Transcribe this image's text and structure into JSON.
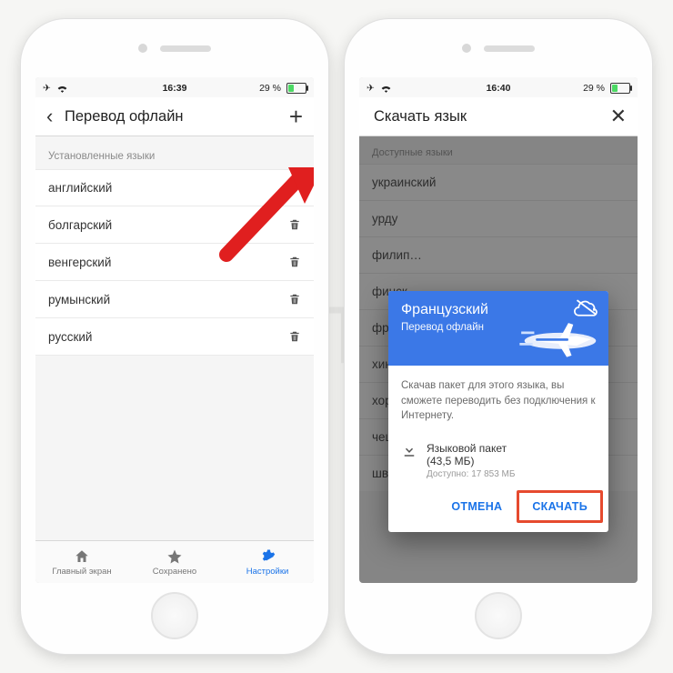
{
  "left": {
    "status": {
      "time": "16:39",
      "battery_text": "29 %"
    },
    "nav": {
      "title": "Перевод офлайн"
    },
    "section_header": "Установленные языки",
    "languages": [
      {
        "name": "английский",
        "deletable": false
      },
      {
        "name": "болгарский",
        "deletable": true
      },
      {
        "name": "венгерский",
        "deletable": true
      },
      {
        "name": "румынский",
        "deletable": true
      },
      {
        "name": "русский",
        "deletable": true
      }
    ],
    "tabs": {
      "home": "Главный экран",
      "saved": "Сохранено",
      "settings": "Настройки"
    }
  },
  "right": {
    "status": {
      "time": "16:40",
      "battery_text": "29 %"
    },
    "nav": {
      "title": "Скачать язык"
    },
    "section_header": "Доступные языки",
    "languages": [
      "украинский",
      "урду",
      "филип…",
      "финск…",
      "францу…",
      "хинди",
      "хорватский",
      "чешский",
      "шведский"
    ],
    "modal": {
      "title": "Французский",
      "subtitle": "Перевод офлайн",
      "body": "Скачав пакет для этого языка, вы сможете переводить без подключения к Интернету.",
      "pkg_title": "Языковой пакет",
      "pkg_size": "(43,5 МБ)",
      "pkg_avail": "Доступно: 17 853 МБ",
      "cancel": "ОТМЕНА",
      "download": "СКАЧАТЬ"
    }
  },
  "icons": {
    "back": "‹",
    "add": "+",
    "close": "✕",
    "airplane_mode": "✈",
    "wifi": "wifi"
  }
}
